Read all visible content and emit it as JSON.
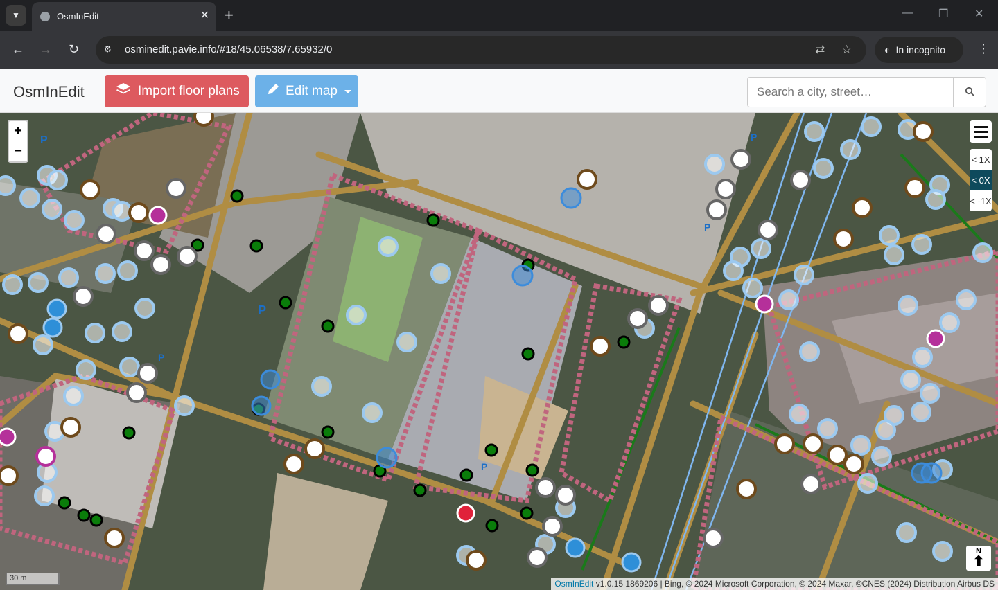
{
  "browser": {
    "tab_title": "OsmInEdit",
    "url": "osminedit.pavie.info/#18/45.06538/7.65932/0",
    "incognito_label": "In incognito"
  },
  "app": {
    "brand": "OsmInEdit",
    "import_button": "Import floor plans",
    "edit_button": "Edit map",
    "search_placeholder": "Search a city, street…"
  },
  "map": {
    "zoom_in": "+",
    "zoom_out": "−",
    "levels": [
      "< 1X",
      "< 0X",
      "< -1X"
    ],
    "active_level": "< 0X",
    "north_label": "N",
    "scale_label": "30 m",
    "attribution_link": "OsmInEdit",
    "attribution_text": " v1.0.15 1869206 | Bing, © 2024 Microsoft Corporation, © 2024 Maxar, ©CNES (2024) Distribution Airbus DS"
  },
  "colors": {
    "import_button": "#dd5a5f",
    "edit_button": "#6cb1e8",
    "road": "#b08d43",
    "building_outline": "#c0657e",
    "poi_green": "#0a7d0a",
    "poi_blue": "#9cc9ef"
  }
}
